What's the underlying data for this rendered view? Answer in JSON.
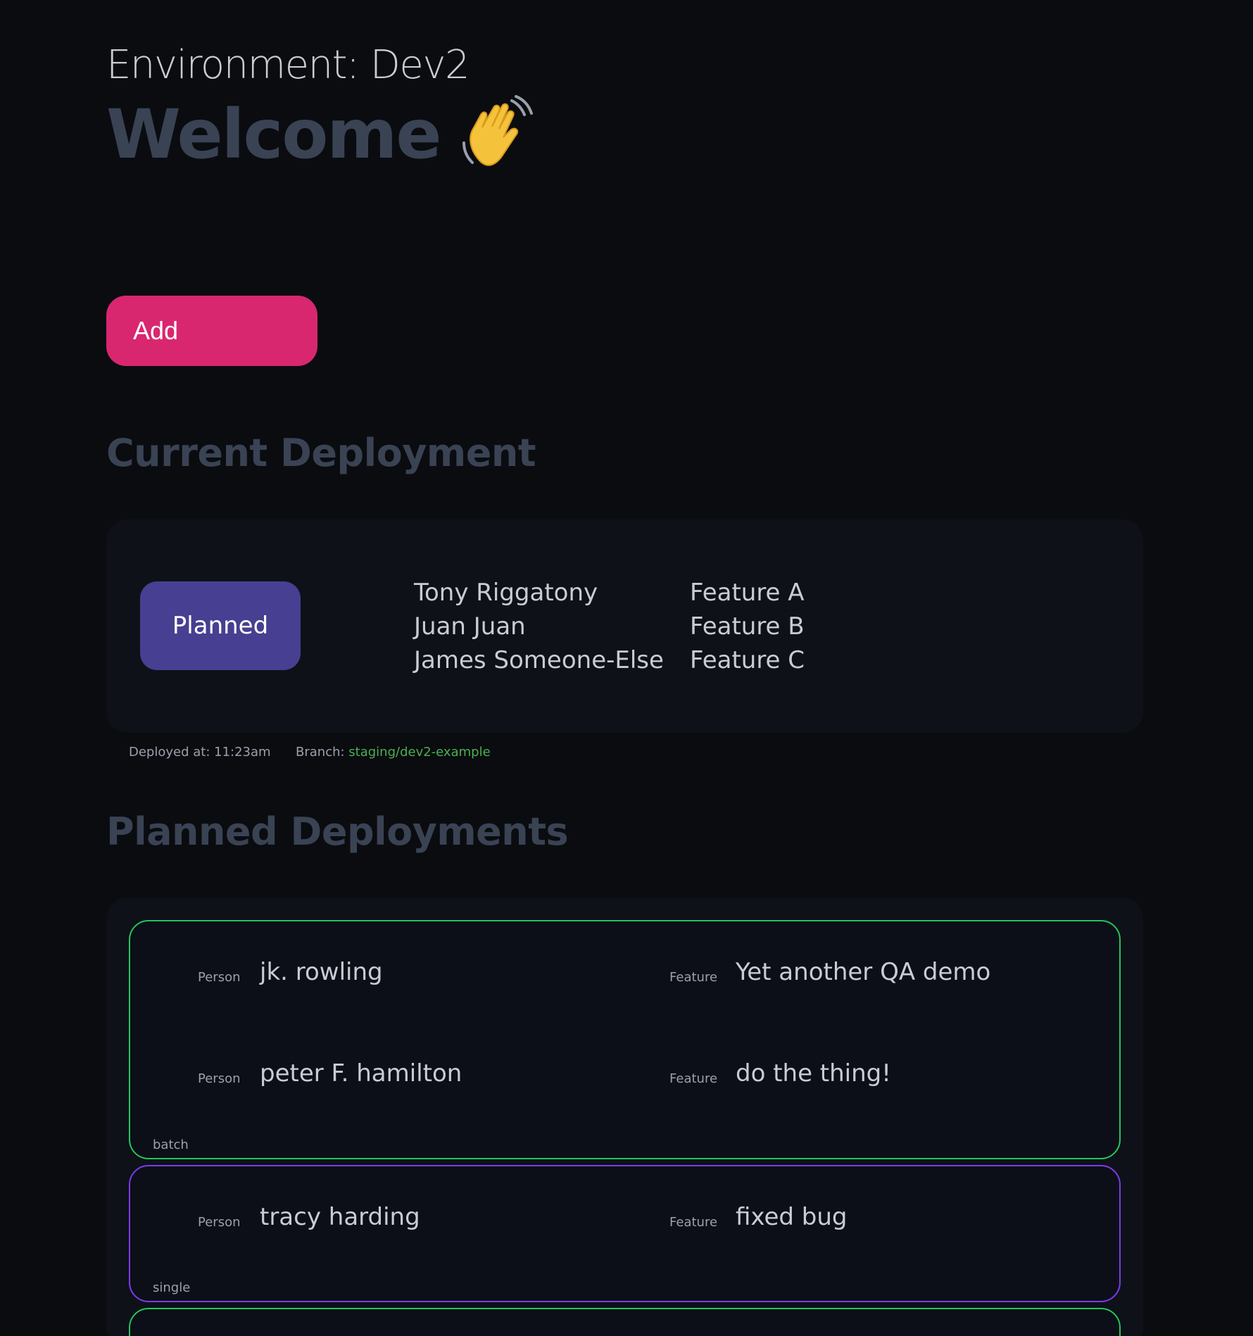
{
  "header": {
    "environment": "Environment: Dev2",
    "welcome": "Welcome",
    "welcome_emoji_icon": "waving-hand-icon"
  },
  "actions": {
    "add_label": "Add"
  },
  "current_deployment": {
    "heading": "Current Deployment",
    "status": "Planned",
    "people": [
      "Tony Riggatony",
      "Juan Juan",
      "James Someone-Else"
    ],
    "features": [
      "Feature A",
      "Feature B",
      "Feature C"
    ],
    "deployed_at_label": "Deployed at: 11:23am",
    "branch_label": "Branch: ",
    "branch_value": "staging/dev2-example"
  },
  "planned_deployments": {
    "heading": "Planned Deployments",
    "groups": [
      {
        "type": "batch",
        "border_color": "#22c55e",
        "rows": [
          {
            "person_label": "Person",
            "person": "jk. rowling",
            "feature_label": "Feature",
            "feature": "Yet another QA demo"
          },
          {
            "person_label": "Person",
            "person": "peter F. hamilton",
            "feature_label": "Feature",
            "feature": "do the thing!"
          }
        ]
      },
      {
        "type": "single",
        "border_color": "#7c3aed",
        "rows": [
          {
            "person_label": "Person",
            "person": "tracy harding",
            "feature_label": "Feature",
            "feature": "fixed bug"
          }
        ]
      }
    ]
  },
  "colors": {
    "background": "#0a0c10",
    "card": "#0e1118",
    "accent_add": "#d8276f",
    "status_planned": "#473f91",
    "branch_text": "#4caf50",
    "heading_muted": "#3a4354"
  }
}
